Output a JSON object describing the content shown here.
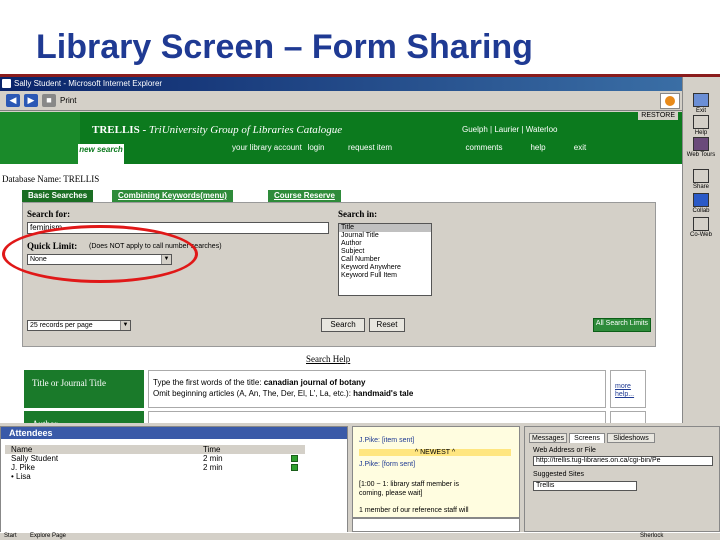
{
  "slide": {
    "title": "Library Screen – Form Sharing"
  },
  "browser": {
    "window_title": "Sally Student - Microsoft Internet Explorer",
    "print_label": "Print",
    "restore_label": "RESTORE"
  },
  "catalogue": {
    "title_main": "TRELLIS - ",
    "title_italic": "TriUniversity Group of Libraries Catalogue",
    "universities": "Guelph | Laurier | Waterloo",
    "nav": [
      {
        "label": "new search"
      },
      {
        "label": "your library account"
      },
      {
        "label": "login"
      },
      {
        "label": "request item"
      },
      {
        "label": "comments"
      },
      {
        "label": "help"
      },
      {
        "label": "exit"
      }
    ],
    "database_name": "Database Name: TRELLIS",
    "tabs": [
      {
        "label": "Basic Searches"
      },
      {
        "label": "Combining Keywords(menu)"
      },
      {
        "label": "Course Reserve"
      }
    ],
    "search_for_label": "Search for:",
    "search_value": "feminism",
    "quick_limit_label": "Quick Limit:",
    "quick_limit_note": "(Does NOT apply to call number searches)",
    "quick_limit_value": "None",
    "search_in_label": "Search in:",
    "search_in_options": [
      "Title",
      "Journal Title",
      "Author",
      "Subject",
      "Call Number",
      "Keyword Anywhere",
      "Keyword Full Item"
    ],
    "records_value": "25 records per page",
    "search_button": "Search",
    "reset_button": "Reset",
    "all_limits_button": "All Search Limits",
    "search_help_label": "Search Help",
    "help_rows": [
      {
        "key": "Title or Journal Title",
        "line1_prefix": "Type the first words of the title: ",
        "line1_example": "canadian journal of botany",
        "line2_prefix": "Omit beginning articles (A, An, The, Der, El, L', La, etc.): ",
        "line2_example": "handmaid's tale",
        "more": "more help..."
      },
      {
        "key": "Author",
        "line1_prefix": "",
        "line1_example": "",
        "line2_prefix": "",
        "line2_example": "",
        "more": ""
      }
    ]
  },
  "side_panel": [
    {
      "label": "Exit"
    },
    {
      "label": "Help"
    },
    {
      "label": "Web Tours"
    },
    {
      "label": "Share"
    },
    {
      "label": "Collab"
    },
    {
      "label": "Co-Web"
    }
  ],
  "attendees": {
    "title": "Attendees",
    "columns": [
      "Name",
      "Time"
    ],
    "rows": [
      {
        "name": "Sally Student",
        "time": "2 min"
      },
      {
        "name": "J. Pike",
        "time": "2 min"
      },
      {
        "name": "• Lisa",
        "time": ""
      }
    ]
  },
  "messages": {
    "line1": "J.Pike: [item sent]",
    "newest": "^ NEWEST ^",
    "line2": "J.Pike: [form sent]",
    "line3": "[1:00 ~ 1: library staff member is",
    "line4": "coming, please wait]",
    "line5": "1 member of our reference staff will",
    "input_placeholder": ""
  },
  "shared_panel": {
    "tabs": [
      "Messages",
      "Screens",
      "Slideshows"
    ],
    "web_address_label": "Web Address or File",
    "web_address_value": "http://trellis.tug-libraries.on.ca/cgi-bin/Pe",
    "suggested_label": "Suggested Sites",
    "suggested_value": "Trellis"
  },
  "taskbar": {
    "start": "Start",
    "task": "Explore Page",
    "tray": "Sherlock"
  }
}
